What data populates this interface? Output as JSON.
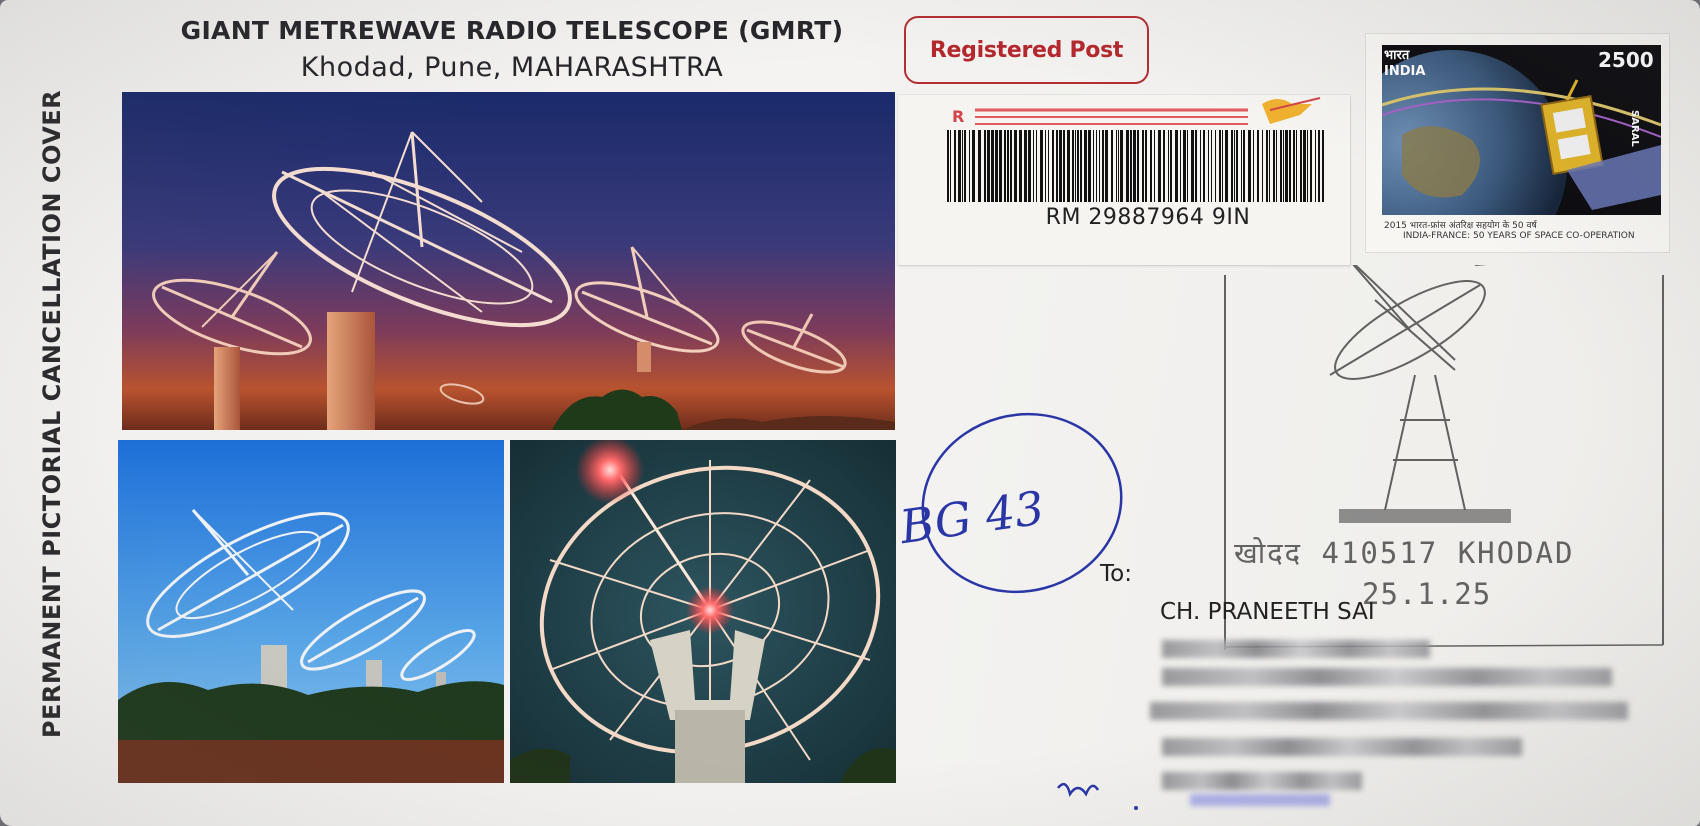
{
  "cover": {
    "side_title": "PERMANENT PICTORIAL CANCELLATION COVER",
    "title": "GIANT METREWAVE RADIO TELESCOPE (GMRT)",
    "subtitle": "Khodad, Pune, MAHARASHTRA"
  },
  "registered": {
    "label": "Registered Post",
    "r_mark": "R",
    "tracking_number": "RM 29887964 9IN",
    "accent_color": "#b4282d"
  },
  "stamp": {
    "country": "INDIA",
    "country_hindi": "भारत",
    "value": "2500",
    "name": "SARAL",
    "caption_line1": "2015  भारत-फ्रांस अंतरिक्ष सहयोग के 50 वर्ष",
    "caption_line2": "INDIA-FRANCE: 50 YEARS OF SPACE CO-OPERATION"
  },
  "postmark": {
    "place": "खोदद 410517 KHODAD",
    "date": "25.1.25"
  },
  "address": {
    "to_label": "To:",
    "name": "CH. PRANEETH SAI"
  },
  "handwriting": {
    "note": "BG 43"
  },
  "photos": {
    "main": "telescope-dishes-dusk",
    "bottom_left": "telescope-dishes-day",
    "bottom_right": "telescope-dish-night"
  }
}
